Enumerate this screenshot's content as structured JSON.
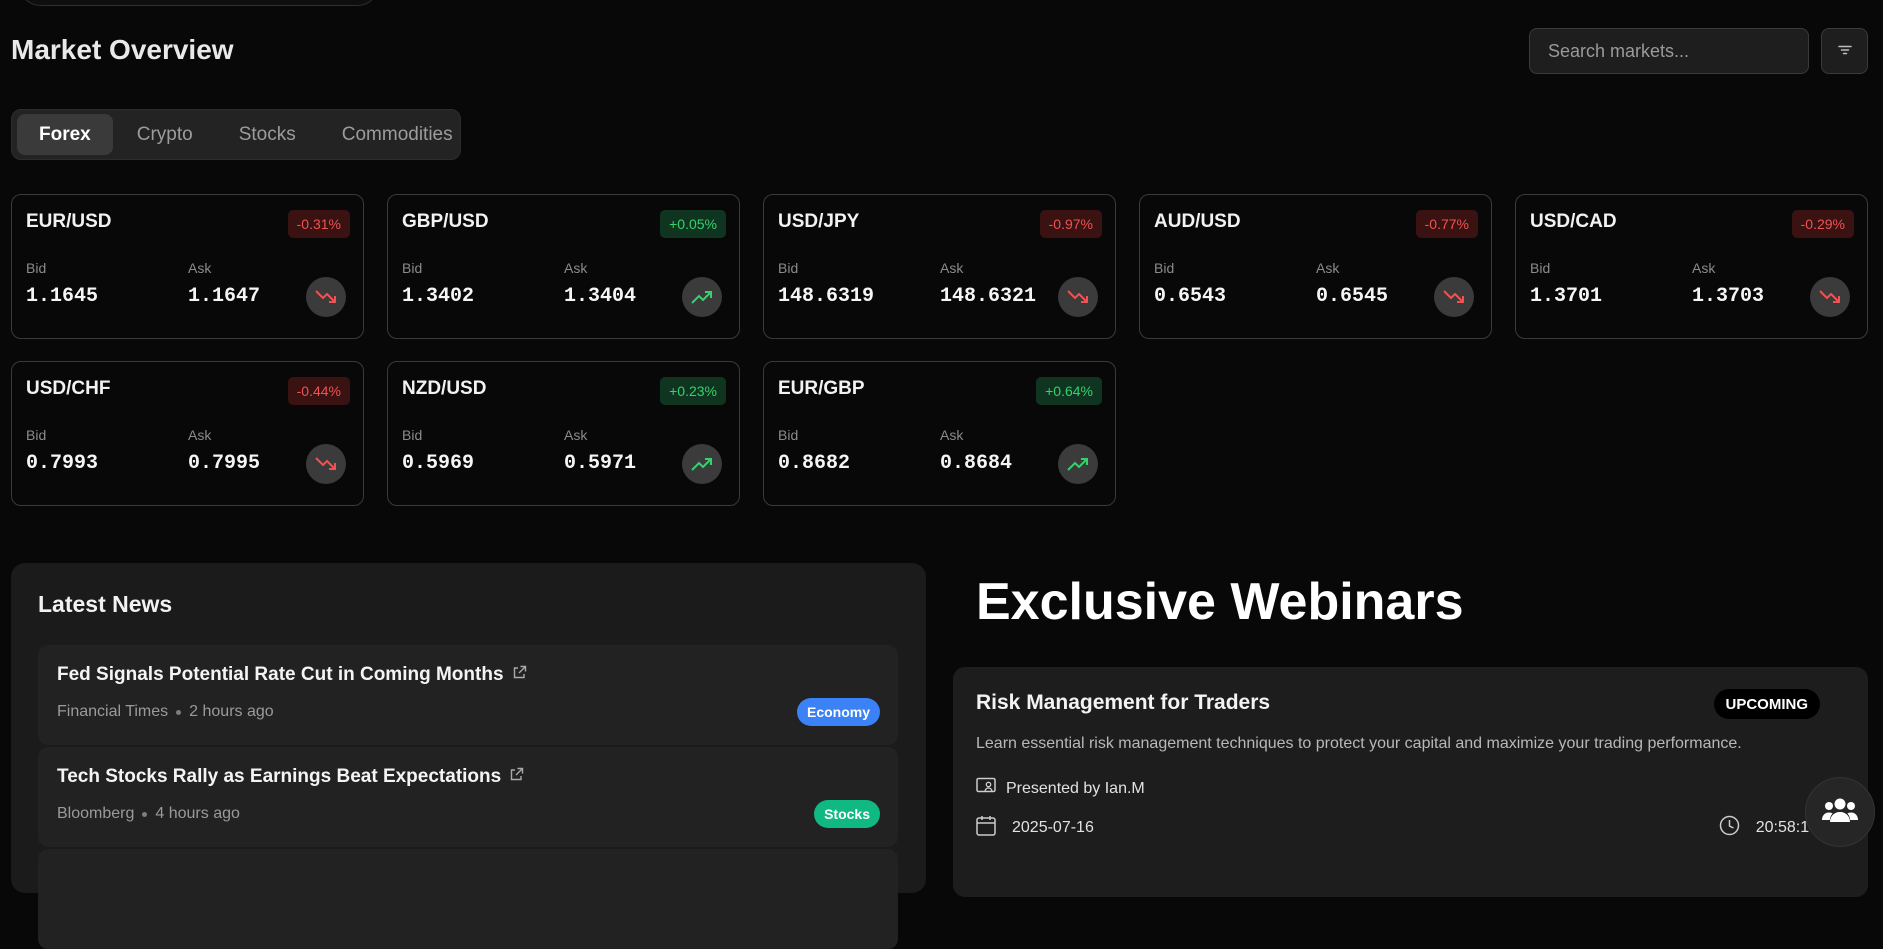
{
  "colors": {
    "background": "#080808",
    "up": "#34d26d",
    "down": "#f05252",
    "economy": "#3b82f6",
    "stocks": "#10b981"
  },
  "header": {
    "title": "Market Overview",
    "search_placeholder": "Search markets...",
    "filter_icon": "filter-icon"
  },
  "tabs": [
    {
      "label": "Forex",
      "active": true
    },
    {
      "label": "Crypto",
      "active": false
    },
    {
      "label": "Stocks",
      "active": false
    },
    {
      "label": "Commodities",
      "active": false
    }
  ],
  "labels": {
    "bid": "Bid",
    "ask": "Ask"
  },
  "markets": [
    {
      "pair": "EUR/USD",
      "change": "-0.31%",
      "direction": "down",
      "bid": "1.1645",
      "ask": "1.1647"
    },
    {
      "pair": "GBP/USD",
      "change": "+0.05%",
      "direction": "up",
      "bid": "1.3402",
      "ask": "1.3404"
    },
    {
      "pair": "USD/JPY",
      "change": "-0.97%",
      "direction": "down",
      "bid": "148.6319",
      "ask": "148.6321"
    },
    {
      "pair": "AUD/USD",
      "change": "-0.77%",
      "direction": "down",
      "bid": "0.6543",
      "ask": "0.6545"
    },
    {
      "pair": "USD/CAD",
      "change": "-0.29%",
      "direction": "down",
      "bid": "1.3701",
      "ask": "1.3703"
    },
    {
      "pair": "USD/CHF",
      "change": "-0.44%",
      "direction": "down",
      "bid": "0.7993",
      "ask": "0.7995"
    },
    {
      "pair": "NZD/USD",
      "change": "+0.23%",
      "direction": "up",
      "bid": "0.5969",
      "ask": "0.5971"
    },
    {
      "pair": "EUR/GBP",
      "change": "+0.64%",
      "direction": "up",
      "bid": "0.8682",
      "ask": "0.8684"
    }
  ],
  "news": {
    "heading": "Latest News",
    "items": [
      {
        "title": "Fed Signals Potential Rate Cut in Coming Months",
        "source": "Financial Times",
        "time": "2 hours ago",
        "tag": "Economy"
      },
      {
        "title": "Tech Stocks Rally as Earnings Beat Expectations",
        "source": "Bloomberg",
        "time": "4 hours ago",
        "tag": "Stocks"
      }
    ]
  },
  "webinars": {
    "heading": "Exclusive Webinars",
    "items": [
      {
        "title": "Risk Management for Traders",
        "status": "UPCOMING",
        "description": "Learn essential risk management techniques to protect your capital and maximize your trading performance.",
        "presenter": "Presented by Ian.M",
        "date": "2025-07-16",
        "time": "20:58:14"
      }
    ]
  }
}
